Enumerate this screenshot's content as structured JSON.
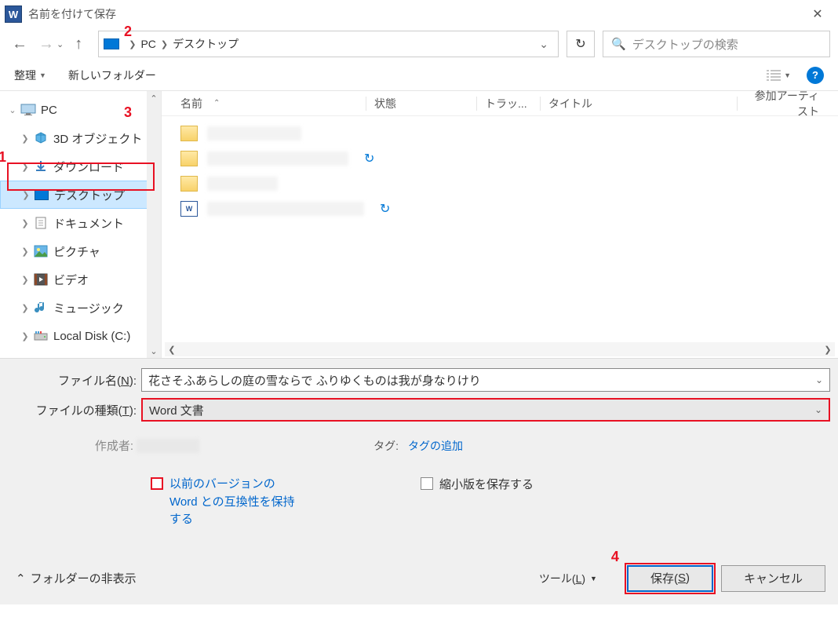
{
  "titlebar": {
    "title": "名前を付けて保存"
  },
  "address": {
    "path1": "PC",
    "path2": "デスクトップ"
  },
  "search": {
    "placeholder": "デスクトップの検索"
  },
  "toolbar": {
    "organize": "整理",
    "new_folder": "新しいフォルダー"
  },
  "tree": {
    "pc": "PC",
    "items": [
      "3D オブジェクト",
      "ダウンロード",
      "デスクトップ",
      "ドキュメント",
      "ピクチャ",
      "ビデオ",
      "ミュージック",
      "Local Disk (C:)"
    ]
  },
  "columns": {
    "name": "名前",
    "state": "状態",
    "track": "トラッ...",
    "title": "タイトル",
    "artist": "参加アーティスト"
  },
  "form": {
    "filename_label": "ファイル名(",
    "filename_label_u": "N",
    "filename_value": "花さそふあらしの庭の雪ならで ふりゆくものは我が身なりけり",
    "filetype_label": "ファイルの種類(",
    "filetype_label_u": "T",
    "filetype_label_end": "):",
    "filetype_value": "Word 文書",
    "author_label": "作成者:",
    "tag_label": "タグ:",
    "tag_link": "タグの追加",
    "compat_label": "以前のバージョンの Word との互換性を保持する",
    "thumb_label": "縮小版を保存する",
    "hide_folders": "フォルダーの非表示",
    "tools": "ツール(",
    "tools_u": "L",
    "tools_end": ")",
    "save": "保存(",
    "save_u": "S",
    "save_end": ")",
    "cancel": "キャンセル"
  },
  "annotations": {
    "a1": "1",
    "a2": "2",
    "a3": "3",
    "a4": "4"
  }
}
